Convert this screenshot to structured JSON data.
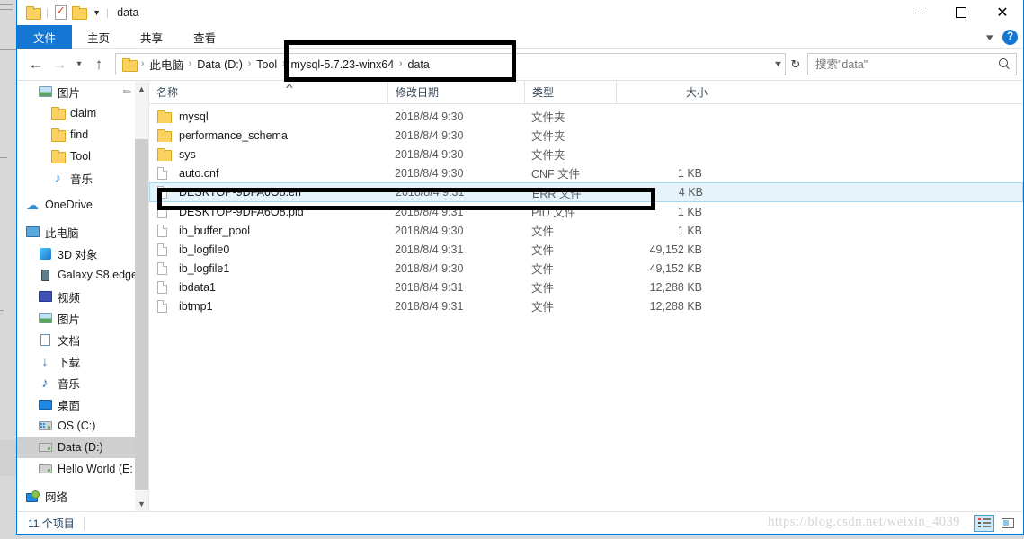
{
  "window": {
    "title": "data",
    "quick_access": [
      "folder-icon",
      "properties-icon",
      "new-folder-icon",
      "customize-caret-icon"
    ],
    "controls": {
      "minimize": "—",
      "maximize": "□",
      "close": "✕"
    }
  },
  "ribbon": {
    "tabs": [
      {
        "label": "文件",
        "active": true
      },
      {
        "label": "主页",
        "active": false
      },
      {
        "label": "共享",
        "active": false
      },
      {
        "label": "查看",
        "active": false
      }
    ],
    "help_label": "?",
    "collapse_icon": "chevron-down-icon"
  },
  "navigation": {
    "back_icon": "←",
    "forward_icon": "→",
    "recent_icon": "ˇ",
    "up_icon": "↑",
    "refresh_icon": "↻",
    "breadcrumb": [
      "此电脑",
      "Data (D:)",
      "Tool",
      "mysql-5.7.23-winx64",
      "data"
    ],
    "breadcrumb_separator": "›"
  },
  "search": {
    "placeholder": "搜索\"data\"",
    "value": "",
    "icon": "search-icon"
  },
  "sidebar": {
    "items": [
      {
        "label": "图片",
        "icon": "pictures-icon",
        "indent": 1,
        "pinned": true,
        "selected": false
      },
      {
        "label": "claim",
        "icon": "folder-icon",
        "indent": 2,
        "pinned": false,
        "selected": false
      },
      {
        "label": "find",
        "icon": "folder-icon",
        "indent": 2,
        "pinned": false,
        "selected": false
      },
      {
        "label": "Tool",
        "icon": "folder-icon",
        "indent": 2,
        "pinned": false,
        "selected": false
      },
      {
        "label": "音乐",
        "icon": "music-icon",
        "indent": 2,
        "pinned": false,
        "selected": false
      },
      {
        "label": "OneDrive",
        "icon": "cloud-icon",
        "indent": 0,
        "pinned": false,
        "selected": false
      },
      {
        "label": "此电脑",
        "icon": "this-pc-icon",
        "indent": 0,
        "pinned": false,
        "selected": false
      },
      {
        "label": "3D 对象",
        "icon": "3d-objects-icon",
        "indent": 1,
        "pinned": false,
        "selected": false
      },
      {
        "label": "Galaxy S8 edge",
        "icon": "phone-icon",
        "indent": 1,
        "pinned": false,
        "selected": false
      },
      {
        "label": "视频",
        "icon": "videos-icon",
        "indent": 1,
        "pinned": false,
        "selected": false
      },
      {
        "label": "图片",
        "icon": "pictures-icon",
        "indent": 1,
        "pinned": false,
        "selected": false
      },
      {
        "label": "文档",
        "icon": "documents-icon",
        "indent": 1,
        "pinned": false,
        "selected": false
      },
      {
        "label": "下载",
        "icon": "downloads-icon",
        "indent": 1,
        "pinned": false,
        "selected": false
      },
      {
        "label": "音乐",
        "icon": "music-icon",
        "indent": 1,
        "pinned": false,
        "selected": false
      },
      {
        "label": "桌面",
        "icon": "desktop-icon",
        "indent": 1,
        "pinned": false,
        "selected": false
      },
      {
        "label": "OS (C:)",
        "icon": "os-drive-icon",
        "indent": 1,
        "pinned": false,
        "selected": false
      },
      {
        "label": "Data (D:)",
        "icon": "drive-icon",
        "indent": 1,
        "pinned": false,
        "selected": true
      },
      {
        "label": "Hello World (E:",
        "icon": "drive-icon",
        "indent": 1,
        "pinned": false,
        "selected": false
      },
      {
        "label": "网络",
        "icon": "network-icon",
        "indent": 0,
        "pinned": false,
        "selected": false
      }
    ]
  },
  "file_list": {
    "columns": [
      {
        "label": "名称",
        "key": "name"
      },
      {
        "label": "修改日期",
        "key": "date"
      },
      {
        "label": "类型",
        "key": "type"
      },
      {
        "label": "大小",
        "key": "size"
      }
    ],
    "sort_indicator": "˄",
    "rows": [
      {
        "name": "mysql",
        "date": "2018/8/4 9:30",
        "type": "文件夹",
        "size": "",
        "icon": "folder-icon",
        "selected": false
      },
      {
        "name": "performance_schema",
        "date": "2018/8/4 9:30",
        "type": "文件夹",
        "size": "",
        "icon": "folder-icon",
        "selected": false
      },
      {
        "name": "sys",
        "date": "2018/8/4 9:30",
        "type": "文件夹",
        "size": "",
        "icon": "folder-icon",
        "selected": false
      },
      {
        "name": "auto.cnf",
        "date": "2018/8/4 9:30",
        "type": "CNF 文件",
        "size": "1 KB",
        "icon": "file-icon",
        "selected": false
      },
      {
        "name": "DESKTOP-9DFA6O8.err",
        "date": "2018/8/4 9:31",
        "type": "ERR 文件",
        "size": "4 KB",
        "icon": "file-icon",
        "selected": true
      },
      {
        "name": "DESKTOP-9DFA6O8.pid",
        "date": "2018/8/4 9:31",
        "type": "PID 文件",
        "size": "1 KB",
        "icon": "file-icon",
        "selected": false
      },
      {
        "name": "ib_buffer_pool",
        "date": "2018/8/4 9:30",
        "type": "文件",
        "size": "1 KB",
        "icon": "file-icon",
        "selected": false
      },
      {
        "name": "ib_logfile0",
        "date": "2018/8/4 9:31",
        "type": "文件",
        "size": "49,152 KB",
        "icon": "file-icon",
        "selected": false
      },
      {
        "name": "ib_logfile1",
        "date": "2018/8/4 9:30",
        "type": "文件",
        "size": "49,152 KB",
        "icon": "file-icon",
        "selected": false
      },
      {
        "name": "ibdata1",
        "date": "2018/8/4 9:31",
        "type": "文件",
        "size": "12,288 KB",
        "icon": "file-icon",
        "selected": false
      },
      {
        "name": "ibtmp1",
        "date": "2018/8/4 9:31",
        "type": "文件",
        "size": "12,288 KB",
        "icon": "file-icon",
        "selected": false
      }
    ]
  },
  "status_bar": {
    "item_count": "11 个项目",
    "watermark": "https://blog.csdn.net/weixin_4039",
    "view_details_icon": "details-view-icon",
    "view_large_icon": "large-icons-view-icon"
  },
  "colors": {
    "accent": "#1477d3",
    "selection": "#e5f3fb",
    "selection_border": "#a8d8ef",
    "folder": "#fbd25f",
    "annotation": "#000000"
  }
}
